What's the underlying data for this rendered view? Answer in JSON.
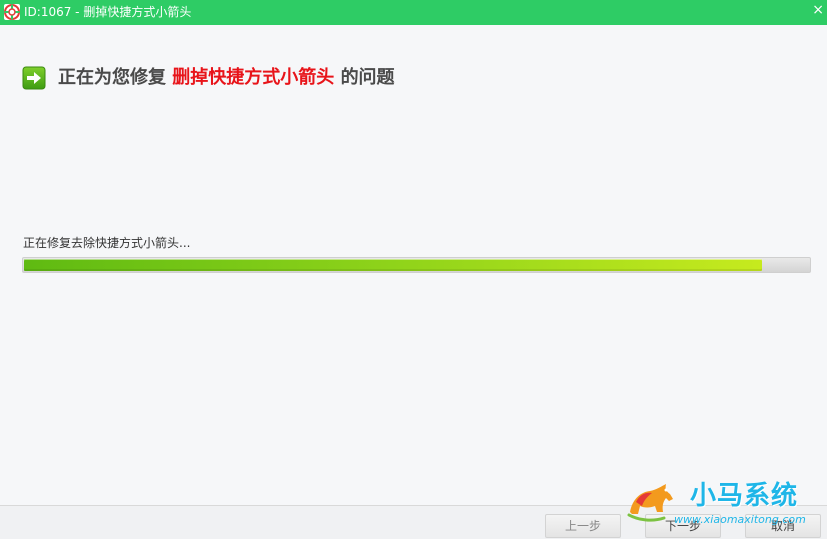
{
  "window": {
    "title": "ID:1067 - 删掉快捷方式小箭头",
    "close_glyph": "×"
  },
  "heading": {
    "prefix": "正在为您修复",
    "highlight": "删掉快捷方式小箭头",
    "suffix": "的问题"
  },
  "progress": {
    "status": "正在修复去除快捷方式小箭头...",
    "fraction": 0.94
  },
  "buttons": {
    "prev": "上一步",
    "next": "下一步",
    "cancel": "取消"
  },
  "watermark": {
    "title": "小马系统",
    "url": "www.xiaomaxitong.com"
  },
  "colors": {
    "titlebar": "#2ecc65",
    "highlight": "#e8141a",
    "progress_fill": "#8fd31a",
    "watermark": "#1fb6e8"
  },
  "icons": {
    "app": "lifebuoy-icon",
    "heading": "right-arrow-icon",
    "close": "close-icon",
    "watermark": "horse-logo-icon"
  }
}
